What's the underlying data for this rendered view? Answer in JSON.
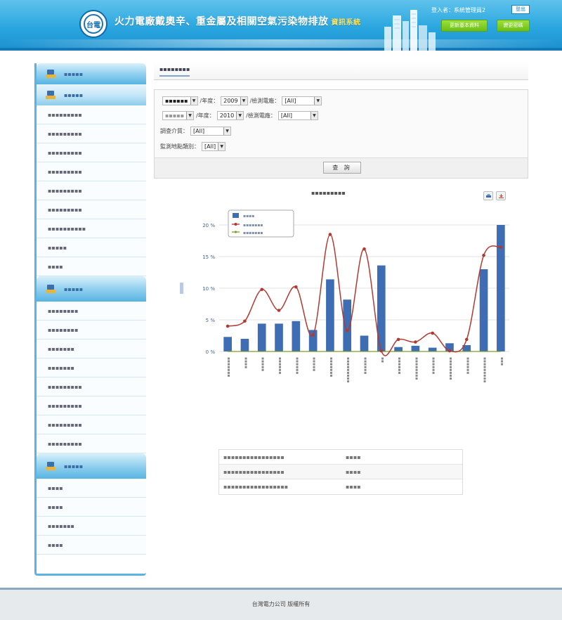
{
  "header": {
    "title": "火力電廠戴奧辛、重金屬及相關空氣污染物排放",
    "subtitle": "資訊系統",
    "logo_text": "台電",
    "login_text": "登入者：系統管理員2",
    "logout_label": "登出",
    "basic_data_label": "更新基本資料",
    "change_password_label": "變更密碼"
  },
  "sidebar": {
    "sections": [
      {
        "label": "▪▪▪▪▪",
        "items": []
      },
      {
        "label": "▪▪▪▪▪",
        "items": [
          "▪▪▪▪▪▪▪▪▪",
          "▪▪▪▪▪▪▪▪▪",
          "▪▪▪▪▪▪▪▪▪",
          "▪▪▪▪▪▪▪▪▪",
          "▪▪▪▪▪▪▪▪▪",
          "▪▪▪▪▪▪▪▪▪",
          "▪▪▪▪▪▪▪▪▪▪",
          "▪▪▪▪▪",
          "▪▪▪▪"
        ]
      },
      {
        "label": "▪▪▪▪▪",
        "items": [
          "▪▪▪▪▪▪▪▪",
          "▪▪▪▪▪▪▪▪",
          "▪▪▪▪▪▪▪",
          "▪▪▪▪▪▪▪",
          "▪▪▪▪▪▪▪▪▪",
          "▪▪▪▪▪▪▪▪▪",
          "▪▪▪▪▪▪▪▪▪",
          "▪▪▪▪▪▪▪▪▪"
        ]
      },
      {
        "label": "▪▪▪▪▪",
        "items": [
          "▪▪▪▪",
          "▪▪▪▪",
          "▪▪▪▪▪▪▪",
          "▪▪▪▪"
        ]
      }
    ]
  },
  "tab": {
    "label": "▪▪▪▪▪▪▪▪"
  },
  "filters": {
    "row1": {
      "prefix_value": "▪▪▪▪▪▪",
      "year_label": "/年度：",
      "year_value": "2009",
      "plant_label": "/檢測電廠：",
      "plant_value": "[All]"
    },
    "row2": {
      "prefix_value": "▪▪▪▪▪",
      "year_label": "/年度：",
      "year_value": "2010",
      "plant_label": "/檢測電廠：",
      "plant_value": "[All]"
    },
    "medium_label": "調查介質：",
    "medium_value": "[All]",
    "site_label": "監測地點類別：",
    "site_value": "[All]",
    "query_label": "查 詢"
  },
  "chart_header": {
    "title": "▪▪▪▪▪▪▪▪▪"
  },
  "colors": {
    "bar": "#3f6db3",
    "line_red": "#b03a33",
    "line_green": "#7a9d2a",
    "header_blue": "#2aa6df",
    "sidebar_border": "#5ab3e0"
  },
  "chart_data": {
    "type": "bar",
    "title": "",
    "ylabel": "",
    "ylim": [
      0,
      20
    ],
    "yticks": [
      "0 %",
      "5 %",
      "10 %",
      "15 %",
      "20 %"
    ],
    "legend_placement": "top-left",
    "grid": true,
    "categories": [
      "▪▪▪▪▪▪▪",
      "▪▪▪▪",
      "▪▪▪▪▪",
      "▪▪▪▪▪▪",
      "▪▪▪▪▪▪",
      "▪▪▪▪▪",
      "▪▪▪▪▪▪▪",
      "▪▪▪▪▪▪▪▪▪",
      "▪▪▪▪▪▪",
      "▪▪",
      "▪▪▪▪▪▪",
      "▪▪▪▪▪▪▪▪",
      "▪▪▪▪▪▪",
      "▪▪▪▪▪▪▪▪",
      "▪▪▪▪▪▪",
      "▪▪▪▪▪▪▪▪▪",
      "▪▪▪"
    ],
    "series": [
      {
        "name": "▪▪▪▪",
        "type": "bar",
        "values": [
          2.3,
          2.0,
          4.4,
          4.4,
          4.8,
          3.4,
          11.4,
          8.2,
          2.5,
          13.6,
          0.7,
          0.9,
          0.6,
          1.3,
          1.0,
          13.0,
          20.0
        ]
      },
      {
        "name": "▪▪▪▪▪▪▪",
        "type": "line",
        "values": [
          4.0,
          4.8,
          9.8,
          6.5,
          10.2,
          2.6,
          18.5,
          3.3,
          16.2,
          0.1,
          1.9,
          1.5,
          2.9,
          0.1,
          1.9,
          15.2,
          16.5
        ]
      },
      {
        "name": "▪▪▪▪▪▪▪",
        "type": "line",
        "values": [
          0,
          0,
          0,
          0,
          0,
          0,
          0,
          0,
          0,
          0,
          0,
          0,
          0,
          0,
          0,
          0,
          0
        ]
      }
    ]
  },
  "summary": {
    "rows": [
      {
        "label": "▪▪▪▪▪▪▪▪▪▪▪▪▪▪▪▪",
        "value": "▪▪▪▪"
      },
      {
        "label": "▪▪▪▪▪▪▪▪▪▪▪▪▪▪▪▪",
        "value": "▪▪▪▪"
      },
      {
        "label": "▪▪▪▪▪▪▪▪▪▪▪▪▪▪▪▪▪",
        "value": "▪▪▪▪"
      }
    ]
  },
  "footer": {
    "text": "台灣電力公司 版權所有"
  }
}
